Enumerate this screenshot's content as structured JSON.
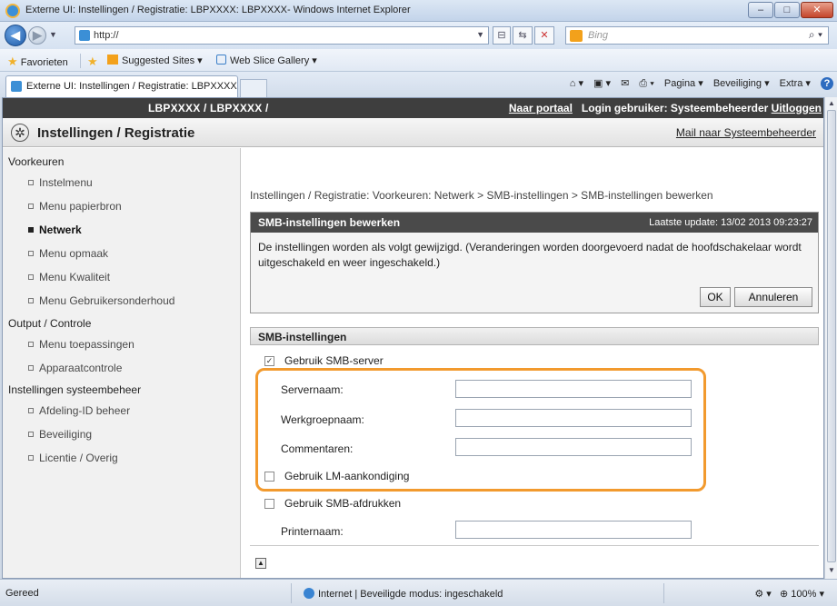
{
  "window": {
    "title": "Externe UI: Instellingen / Registratie: LBPXXXX: LBPXXXX- Windows Internet Explorer",
    "min": "–",
    "max": "□",
    "close": "✕"
  },
  "address_bar": {
    "url": "http://",
    "search_placeholder": "Bing"
  },
  "favorites_bar": {
    "favorites": "Favorieten",
    "suggested": "Suggested Sites ▾",
    "webslice": "Web Slice Gallery ▾"
  },
  "tab": {
    "title": "Externe UI: Instellingen / Registratie: LBPXXXX: LB..."
  },
  "command_bar": {
    "pagina": "Pagina ▾",
    "beveiliging": "Beveiliging ▾",
    "extra": "Extra ▾"
  },
  "page_header": {
    "model": "LBPXXXX / LBPXXXX /",
    "portal_link": "Naar portaal",
    "login_user": "Login gebruiker: Systeembeheerder",
    "logout_link": "Uitloggen"
  },
  "sub_header": {
    "title": "Instellingen / Registratie",
    "mail_link": "Mail naar Systeembeheerder"
  },
  "sidebar": {
    "groups": [
      {
        "label": "Voorkeuren",
        "items": [
          "Instelmenu",
          "Menu papierbron",
          "Netwerk",
          "Menu opmaak",
          "Menu Kwaliteit",
          "Menu Gebruikersonderhoud"
        ]
      },
      {
        "label": "Output / Controle",
        "items": [
          "Menu toepassingen",
          "Apparaatcontrole"
        ]
      },
      {
        "label": "Instellingen systeembeheer",
        "items": [
          "Afdeling-ID beheer",
          "Beveiliging",
          "Licentie / Overig"
        ]
      }
    ]
  },
  "main": {
    "breadcrumb": "Instellingen / Registratie: Voorkeuren: Netwerk > SMB-instellingen > SMB-instellingen bewerken",
    "edit_box": {
      "title": "SMB-instellingen bewerken",
      "last_update": "Laatste update: 13/02 2013 09:23:27",
      "message": "De instellingen worden als volgt gewijzigd. (Veranderingen worden doorgevoerd nadat de hoofdschakelaar wordt uitgeschakeld en weer ingeschakeld.)",
      "ok": "OK",
      "cancel": "Annuleren"
    },
    "smb": {
      "section_title": "SMB-instellingen",
      "use_server": "Gebruik SMB-server",
      "server_name": "Servernaam:",
      "workgroup": "Werkgroepnaam:",
      "comments": "Commentaren:",
      "use_lm": "Gebruik LM-aankondiging",
      "use_print": "Gebruik SMB-afdrukken",
      "printer_name": "Printernaam:"
    }
  },
  "status_bar": {
    "left": "Gereed",
    "zone": "Internet | Beveiligde modus: ingeschakeld",
    "zoom": "100%"
  },
  "colors": {
    "highlight": "#f29a2e",
    "header_dark": "#3e3e3e"
  }
}
